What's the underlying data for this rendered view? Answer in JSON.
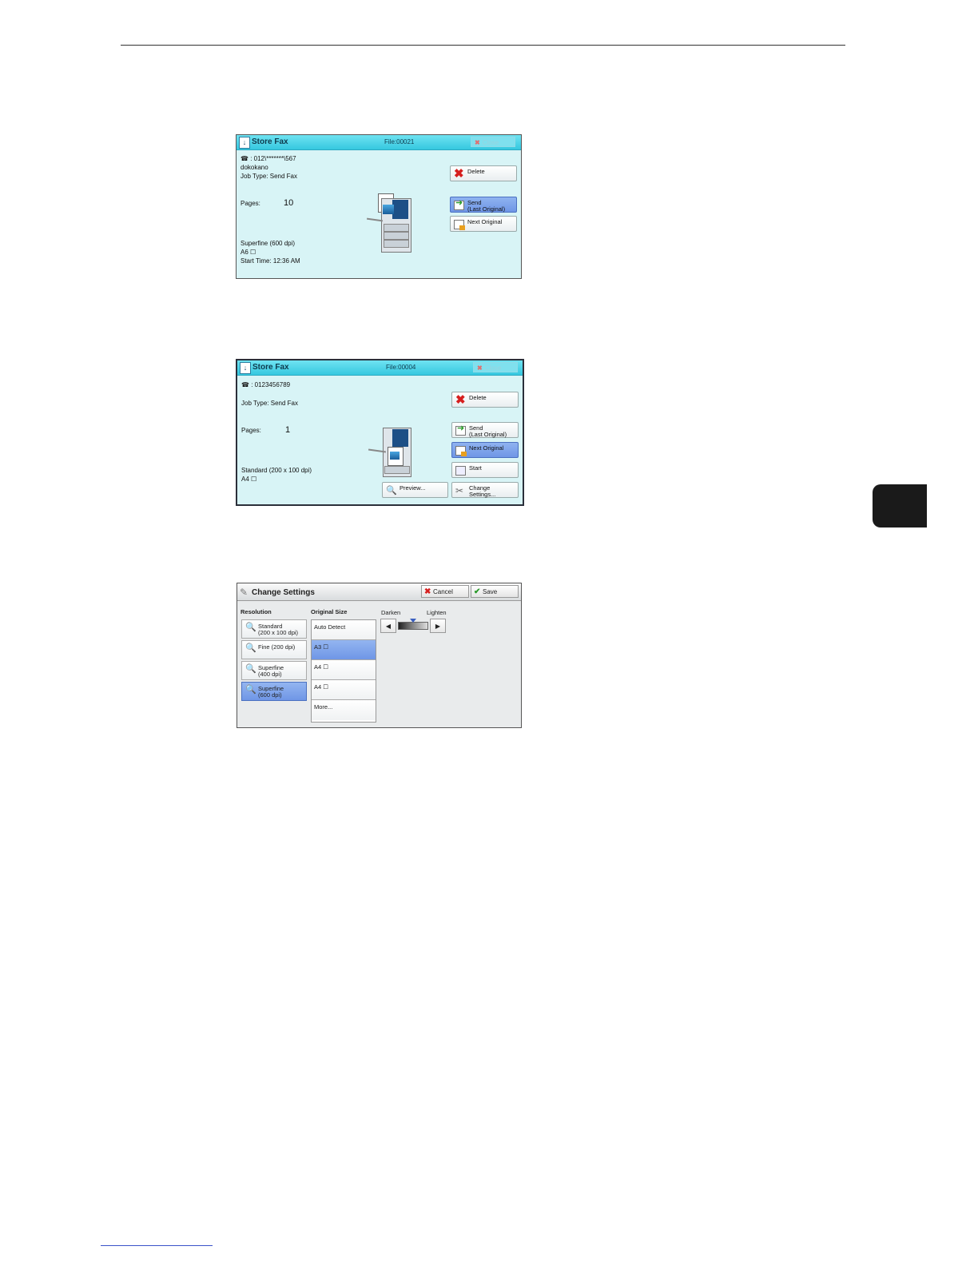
{
  "screen1": {
    "title": "Store Fax",
    "file": "File:00021",
    "close_label": "Close",
    "fax_number": "☎ : 012\\*******\\567",
    "recipient": "dokokano",
    "job_type": "Job Type: Send Fax",
    "pages_label": "Pages:",
    "pages_value": "10",
    "resolution": "Superfine (600 dpi)",
    "size": "A6 ☐",
    "start_time": "Start Time: 12:36 AM",
    "buttons": {
      "delete": "Delete",
      "send": "Send\n(Last Original)",
      "next": "Next Original"
    }
  },
  "screen2": {
    "title": "Store Fax",
    "file": "File:00004",
    "close_label": "Close",
    "fax_number": "☎ : 0123456789",
    "job_type": "Job Type: Send Fax",
    "pages_label": "Pages:",
    "pages_value": "1",
    "resolution": "Standard (200 x 100 dpi)",
    "size": "A4 ☐",
    "buttons": {
      "delete": "Delete",
      "send": "Send\n(Last Original)",
      "next": "Next Original",
      "start": "Start",
      "preview": "Preview...",
      "change": "Change\nSettings..."
    }
  },
  "screen3": {
    "title": "Change Settings",
    "cancel": "Cancel",
    "save": "Save",
    "resolution_label": "Resolution",
    "original_size_label": "Original Size",
    "darken_label": "Darken",
    "lighten_label": "Lighten",
    "resolutions": [
      {
        "label": "Standard\n(200 x 100 dpi)"
      },
      {
        "label": "Fine (200 dpi)"
      },
      {
        "label": "Superfine\n(400 dpi)"
      },
      {
        "label": "Superfine\n(600 dpi)"
      }
    ],
    "sizes": [
      {
        "label": "Auto Detect"
      },
      {
        "label": "A3 ☐"
      },
      {
        "label": "A4 ☐"
      },
      {
        "label": "A4 ☐"
      },
      {
        "label": "More..."
      }
    ],
    "selected_resolution": "Superfine\n(600 dpi)",
    "selected_size": "A3 ☐"
  },
  "colors": {
    "screen_bg": "#d8f4f6",
    "titlebar": "#35c8e0",
    "selected": "#6f96e6"
  }
}
